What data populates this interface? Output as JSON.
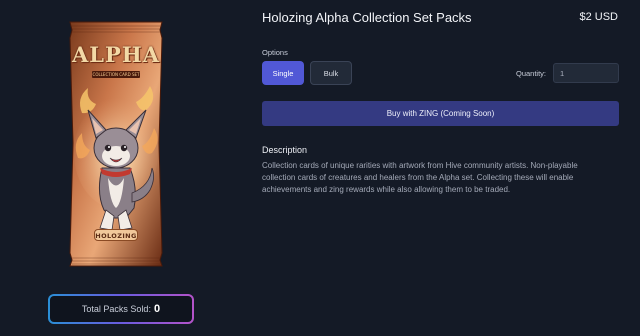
{
  "product": {
    "title": "Holozing Alpha Collection Set Packs",
    "price": "$2 USD"
  },
  "pack": {
    "name": "ALPHA",
    "subtitle": "COLLECTION CARD SET",
    "logo": "HOLOZING",
    "icon": "creature-pack-art"
  },
  "sold": {
    "label": "Total Packs Sold:",
    "count": "0"
  },
  "options": {
    "label": "Options",
    "single": "Single",
    "bulk": "Bulk",
    "selected": "Single"
  },
  "quantity": {
    "label": "Quantity:",
    "value": "1"
  },
  "buy": {
    "label": "Buy with ZING (Coming Soon)"
  },
  "description": {
    "title": "Description",
    "text": "Collection cards of unique rarities with artwork from Hive community artists. Non-playable collection cards of creatures and healers from the Alpha set. Collecting these will enable achievements and zing rewards while also allowing them to be traded."
  },
  "colors": {
    "background": "#141a26",
    "accent": "#5158d6",
    "buy_button": "#343a82"
  }
}
